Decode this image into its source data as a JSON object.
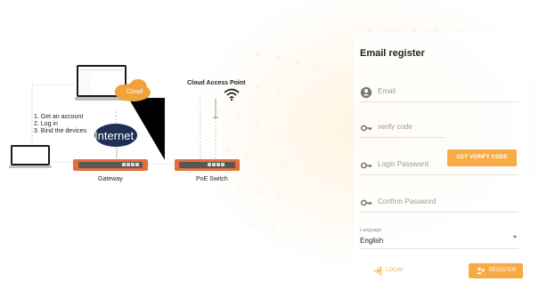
{
  "panel": {
    "title": "Email register",
    "email_label": "Email",
    "verify_label": "verify code",
    "verify_button": "GET VERIFY CODE",
    "password_label": "Login Password",
    "confirm_label": "Confirm Password",
    "language_label": "Language",
    "language_value": "English",
    "login_button": "LOGIN",
    "register_button": "REGISTER"
  },
  "illustration": {
    "cloud_label": "Cloud",
    "internet_label": "Internet",
    "access_point_label": "Cloud Access Point",
    "gateway_label": "Gateway",
    "poe_switch_label": "PoE Switch",
    "steps": [
      "1. Get an account",
      "2. Log in",
      "3. Bind the devices"
    ]
  },
  "colors": {
    "accent": "#f7ab45",
    "cloud": "#f0a33b",
    "internet": "#1f2f55",
    "device_orange": "#e46d3a"
  }
}
